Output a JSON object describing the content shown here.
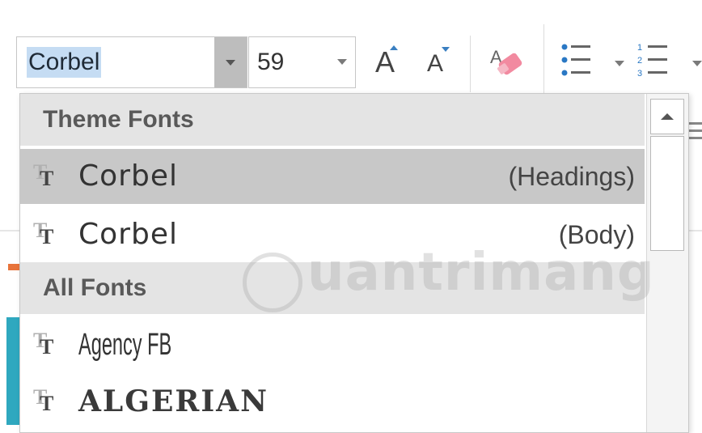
{
  "ribbon": {
    "font_name": "Corbel",
    "font_size": "59",
    "grow_font_glyph": "A",
    "shrink_font_glyph": "A"
  },
  "font_dropdown": {
    "sections": [
      {
        "title": "Theme Fonts",
        "items": [
          {
            "name": "Corbel",
            "tag": "(Headings)",
            "selected": true
          },
          {
            "name": "Corbel",
            "tag": "(Body)",
            "selected": false
          }
        ]
      },
      {
        "title": "All Fonts",
        "items": [
          {
            "name": "Agency FB",
            "tag": "",
            "selected": false
          },
          {
            "name": "ALGERIAN",
            "tag": "",
            "selected": false
          }
        ]
      }
    ],
    "font_type_icon": "truetype-icon"
  },
  "watermark": {
    "text": "uantrimang"
  },
  "colors": {
    "selection_highlight": "#c5dcf3",
    "selected_row": "#c8c8c8",
    "section_header": "#e4e4e4",
    "accent_teal": "#2fa8bf",
    "accent_orange": "#e8743b",
    "clear_format_pink": "#f28aa0"
  }
}
